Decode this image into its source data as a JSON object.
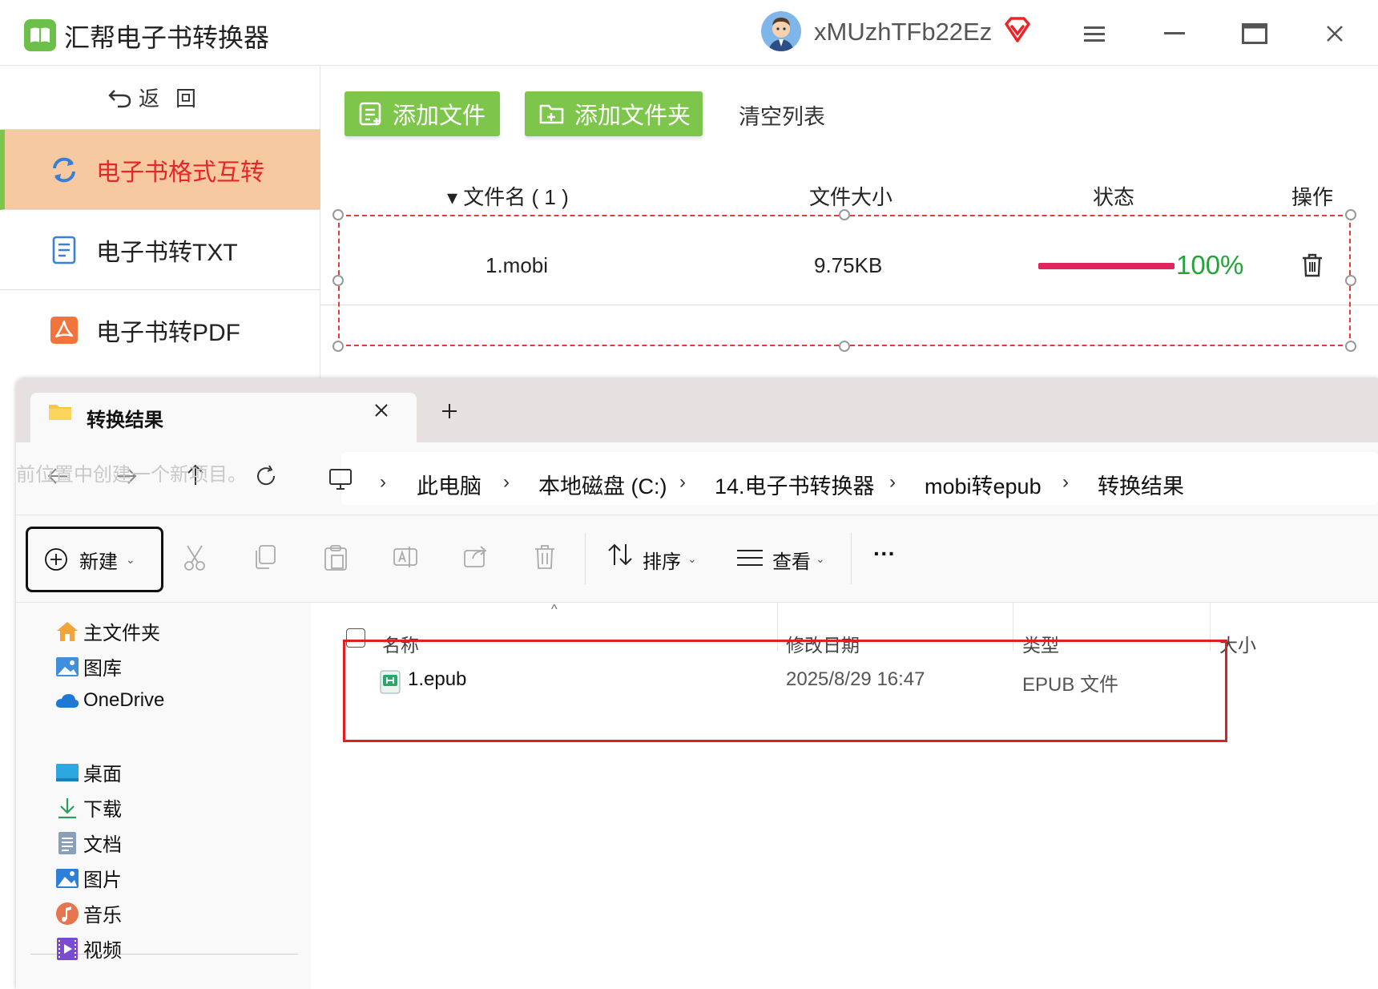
{
  "app": {
    "title": "汇帮电子书转换器",
    "username": "xMUzhTFb22Ez",
    "accent": "#7ec64b"
  },
  "sidebar": {
    "back_label": "返回",
    "items": [
      {
        "label": "电子书格式互转",
        "icon": "refresh-icon",
        "active": true
      },
      {
        "label": "电子书转TXT",
        "icon": "document-icon",
        "active": false
      },
      {
        "label": "电子书转PDF",
        "icon": "pdf-icon",
        "active": false
      }
    ]
  },
  "toolbar": {
    "add_file": "添加文件",
    "add_folder": "添加文件夹",
    "clear_list": "清空列表"
  },
  "table": {
    "headers": {
      "name": "▾ 文件名 ( 1 )",
      "size": "文件大小",
      "status": "状态",
      "action": "操作"
    },
    "rows": [
      {
        "name": "1.mobi",
        "size": "9.75KB",
        "progress": "100%"
      }
    ]
  },
  "explorer": {
    "tab_title": "转换结果",
    "ghost_text": "前位置中创建一个新项目。",
    "breadcrumb": [
      "此电脑",
      "本地磁盘 (C:)",
      "14.电子书转换器",
      "mobi转epub",
      "转换结果"
    ],
    "commands": {
      "new": "新建",
      "sort": "排序",
      "view": "查看",
      "more": "···"
    },
    "tree_top": [
      {
        "label": "主文件夹",
        "icon": "home-icon"
      },
      {
        "label": "图库",
        "icon": "gallery-icon"
      },
      {
        "label": "OneDrive",
        "icon": "cloud-icon"
      }
    ],
    "tree_quick": [
      {
        "label": "桌面",
        "icon": "desktop-icon"
      },
      {
        "label": "下载",
        "icon": "download-icon"
      },
      {
        "label": "文档",
        "icon": "documents-icon"
      },
      {
        "label": "图片",
        "icon": "pictures-icon"
      },
      {
        "label": "音乐",
        "icon": "music-icon"
      },
      {
        "label": "视频",
        "icon": "video-icon"
      }
    ],
    "columns": {
      "name": "名称",
      "date": "修改日期",
      "type": "类型",
      "size": "大小"
    },
    "files": [
      {
        "name": "1.epub",
        "date": "2025/8/29 16:47",
        "type": "EPUB 文件"
      }
    ]
  }
}
